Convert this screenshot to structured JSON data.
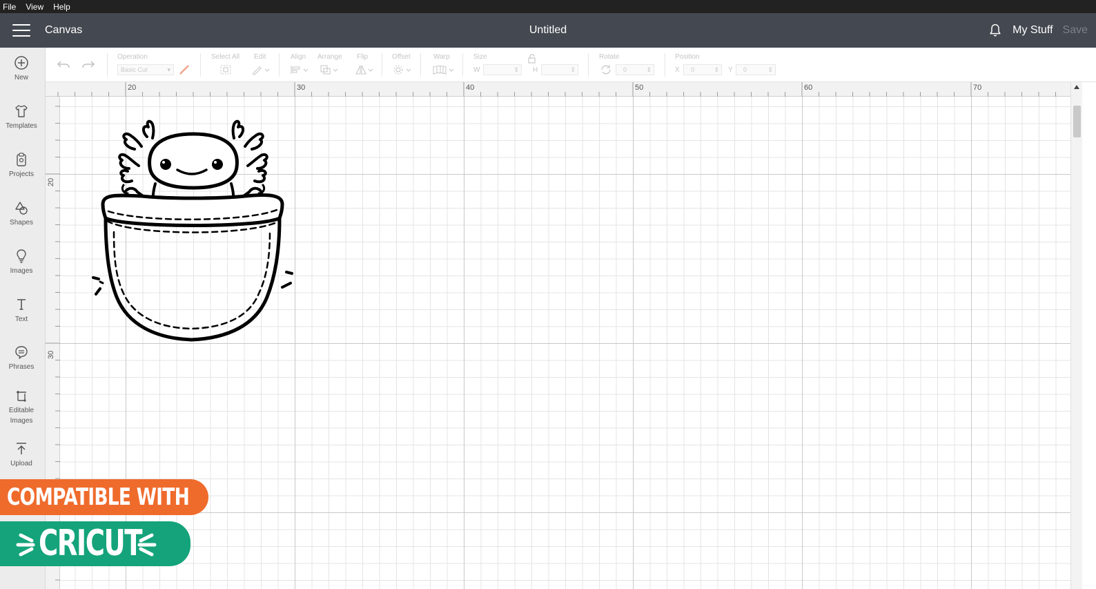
{
  "menubar": {
    "items": [
      "File",
      "View",
      "Help"
    ]
  },
  "header": {
    "app_name": "Canvas",
    "document_title": "Untitled",
    "my_stuff_label": "My Stuff",
    "save_label": "Save"
  },
  "sidebar": {
    "items": [
      {
        "label": "New",
        "icon": "plus-circle-icon"
      },
      {
        "label": "Templates",
        "icon": "tshirt-icon"
      },
      {
        "label": "Projects",
        "icon": "clipboard-icon"
      },
      {
        "label": "Shapes",
        "icon": "shapes-icon"
      },
      {
        "label": "Images",
        "icon": "lightbulb-icon"
      },
      {
        "label": "Text",
        "icon": "text-icon"
      },
      {
        "label": "Phrases",
        "icon": "speech-bubble-icon"
      },
      {
        "label": "Editable Images",
        "icon": "editable-image-icon"
      },
      {
        "label": "Upload",
        "icon": "upload-icon"
      }
    ]
  },
  "toolbar": {
    "operation_label": "Operation",
    "operation_value": "Basic Cut",
    "select_all_label": "Select All",
    "edit_label": "Edit",
    "align_label": "Align",
    "arrange_label": "Arrange",
    "flip_label": "Flip",
    "offset_label": "Offset",
    "warp_label": "Warp",
    "size_label": "Size",
    "size_w_label": "W",
    "size_h_label": "H",
    "rotate_label": "Rotate",
    "rotate_value": "0",
    "position_label": "Position",
    "position_x_label": "X",
    "position_x_value": "0",
    "position_y_label": "Y",
    "position_y_value": "0"
  },
  "ruler": {
    "top_numbers": [
      "20",
      "30",
      "40",
      "50",
      "60",
      "70"
    ],
    "left_numbers": [
      "20",
      "30"
    ]
  },
  "badges": {
    "compatible_text": "COMPATIBLE WITH",
    "cricut_text": "CRICUT"
  },
  "colors": {
    "header_bg": "#444850",
    "badge_orange": "#ef6b2c",
    "badge_green": "#14a37a"
  }
}
